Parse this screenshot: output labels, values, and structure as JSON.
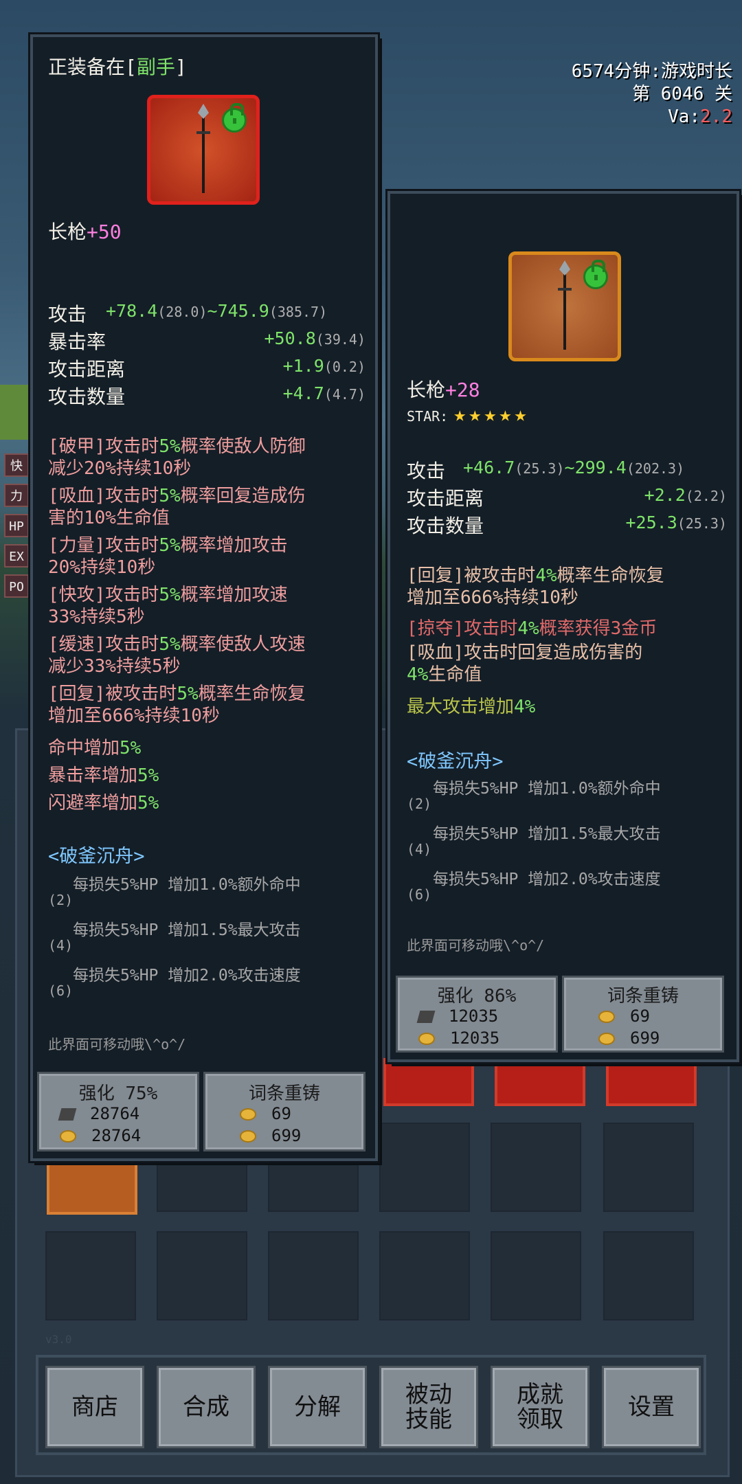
{
  "hud": {
    "playtime": "6574分钟:游戏时长",
    "level": "第 6046 关",
    "va_label": "Va:",
    "va_value": "2.2"
  },
  "side_chips": [
    "快",
    "力",
    "HP",
    "EX",
    "PO"
  ],
  "version": "v3.0",
  "left_panel": {
    "equipped_prefix": "正装备在[",
    "equipped_slot": "副手",
    "equipped_suffix": "]",
    "item_name": "长枪",
    "item_level": "+50",
    "stats": [
      {
        "name": "攻击",
        "value": "+78.4",
        "base": "(28.0)",
        "value2": "~745.9",
        "base2": "(385.7)"
      },
      {
        "name": "暴击率",
        "value": "+50.8",
        "base": "(39.4)"
      },
      {
        "name": "攻击距离",
        "value": "+1.9",
        "base": "(0.2)"
      },
      {
        "name": "攻击数量",
        "value": "+4.7",
        "base": "(4.7)"
      }
    ],
    "effects": [
      {
        "l1a": "[破甲]攻击时",
        "l1b": "5%",
        "l1c": "概率使敌人防御",
        "l2": "减少20%持续10秒"
      },
      {
        "l1a": "[吸血]攻击时",
        "l1b": "5%",
        "l1c": "概率回复造成伤",
        "l2": "害的10%生命值"
      },
      {
        "l1a": "[力量]攻击时",
        "l1b": "5%",
        "l1c": "概率增加攻击",
        "l2": "20%持续10秒"
      },
      {
        "l1a": "[快攻]攻击时",
        "l1b": "5%",
        "l1c": "概率增加攻速",
        "l2": "33%持续5秒"
      },
      {
        "l1a": "[缓速]攻击时",
        "l1b": "5%",
        "l1c": "概率使敌人攻速",
        "l2": "减少33%持续5秒"
      },
      {
        "l1a": "[回复]被攻击时",
        "l1b": "5%",
        "l1c": "概率生命恢复",
        "l2": "增加至666%持续10秒"
      }
    ],
    "bonuses": [
      {
        "a": "命中增加",
        "b": "5%"
      },
      {
        "a": "暴击率增加",
        "b": "5%"
      },
      {
        "a": "闪避率增加",
        "b": "5%"
      }
    ],
    "set_name": "<破釜沉舟>",
    "set_rows": [
      {
        "text": "每损失5%HP  增加1.0%额外命中",
        "count": "(2)"
      },
      {
        "text": "每损失5%HP  增加1.5%最大攻击",
        "count": "(4)"
      },
      {
        "text": "每损失5%HP  增加2.0%攻击速度",
        "count": "(6)"
      }
    ],
    "hint": "此界面可移动哦\\^o^/",
    "enhance_label": "强化 75%",
    "enhance_cost1": "28764",
    "enhance_cost2": "28764",
    "reforge_label": "词条重铸",
    "reforge_cost1": "69",
    "reforge_cost2": "699"
  },
  "right_panel": {
    "item_name": "长枪",
    "item_level": "+28",
    "star_label": "STAR:",
    "stars": 5,
    "stats": [
      {
        "name": "攻击",
        "value": "+46.7",
        "base": "(25.3)",
        "value2": "~299.4",
        "base2": "(202.3)"
      },
      {
        "name": "攻击距离",
        "value": "+2.2",
        "base": "(2.2)"
      },
      {
        "name": "攻击数量",
        "value": "+25.3",
        "base": "(25.3)"
      }
    ],
    "effect1_a": "[回复]被攻击时",
    "effect1_b": "4%",
    "effect1_c": "概率生命恢复",
    "effect1_l2": "增加至666%持续10秒",
    "effect2_a": "[掠夺]攻击时",
    "effect2_b": "4%",
    "effect2_c": "概率获得3金币",
    "effect3_a": "[吸血]攻击时回复造成伤害的",
    "effect3_b": "4%",
    "effect3_c": "生命值",
    "bonus_a": "最大攻击增加",
    "bonus_b": "4%",
    "set_name": "<破釜沉舟>",
    "set_rows": [
      {
        "text": "每损失5%HP  增加1.0%额外命中",
        "count": "(2)"
      },
      {
        "text": "每损失5%HP  增加1.5%最大攻击",
        "count": "(4)"
      },
      {
        "text": "每损失5%HP  增加2.0%攻击速度",
        "count": "(6)"
      }
    ],
    "hint": "此界面可移动哦\\^o^/",
    "enhance_label": "强化 86%",
    "enhance_cost1": "12035",
    "enhance_cost2": "12035",
    "reforge_label": "词条重铸",
    "reforge_cost1": "69",
    "reforge_cost2": "699"
  },
  "nav": [
    {
      "label": "商店"
    },
    {
      "label": "合成"
    },
    {
      "label": "分解"
    },
    {
      "label": "被动\n技能"
    },
    {
      "label": "成就\n领取"
    },
    {
      "label": "设置"
    }
  ]
}
